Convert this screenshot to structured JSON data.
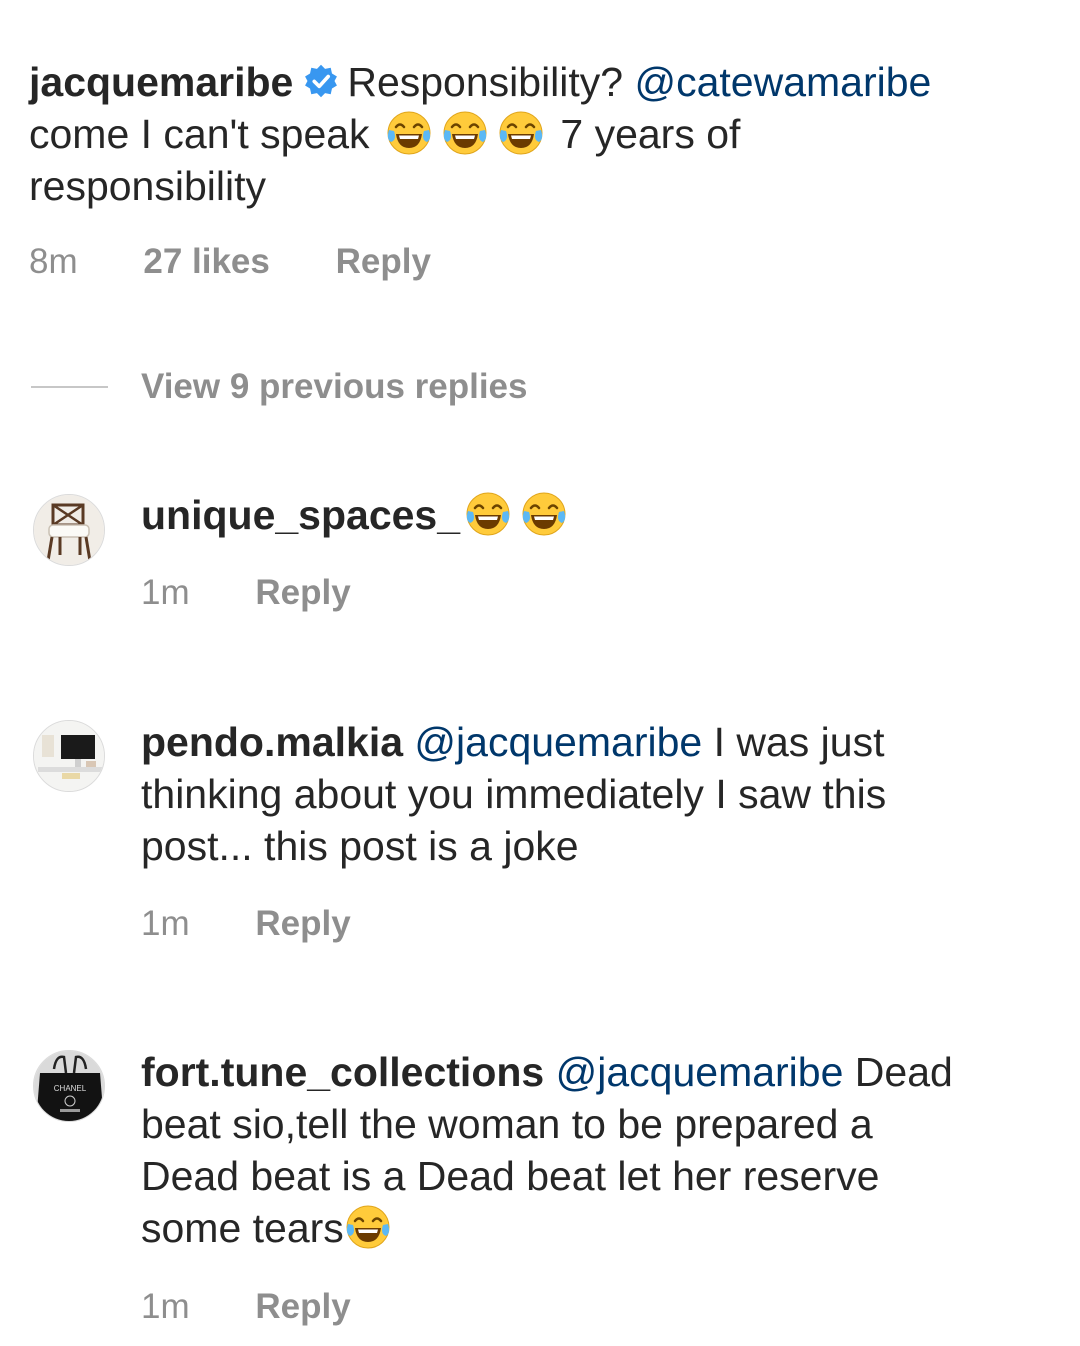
{
  "main_comment": {
    "username": "jacquemaribe",
    "text_before_mention": "Responsibility? ",
    "mention": "@catewamaribe",
    "line2_start": "come I can't speak",
    "line2_end": "7 years of",
    "line3": "responsibility",
    "time": "8m",
    "likes": "27 likes",
    "reply_label": "Reply"
  },
  "view_replies": "View 9 previous replies",
  "replies": [
    {
      "username": "unique_spaces_",
      "time": "1m",
      "reply_label": "Reply"
    },
    {
      "username": "pendo.malkia",
      "mention": "@jacquemaribe",
      "line1_rest": " I was just",
      "line2": "thinking about you immediately I saw this",
      "line3": "post... this post is a joke",
      "time": "1m",
      "reply_label": "Reply"
    },
    {
      "username": "fort.tune_collections",
      "mention": "@jacquemaribe",
      "line1_rest": " Dead",
      "line2": "beat sio,tell the woman to be prepared a",
      "line3": "Dead beat is a Dead beat let her reserve",
      "line4": "some tears",
      "time": "1m",
      "reply_label": "Reply"
    }
  ],
  "avatar_text": {
    "brand": "CHANEL"
  },
  "colors": {
    "mention": "#00376b",
    "meta": "#8e8e8e",
    "verified": "#3897f0",
    "emoji_face": "#ffcb3b"
  },
  "icons": {
    "verified": "verified-badge-icon",
    "emoji": "face-with-tears-of-joy-icon"
  }
}
